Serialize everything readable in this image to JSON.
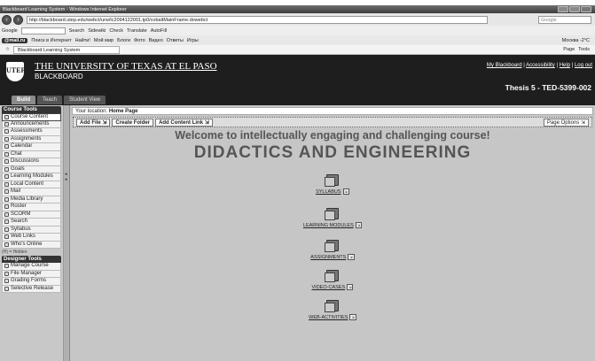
{
  "browser": {
    "window_title": "Blackboard Learning System - Windows Internet Explorer",
    "url": "http://blackboard.utep.edu/webct/urw/lc2094122001.tp0/cobaltMainFrame.dowebct",
    "search_placeholder": "Google",
    "google_label": "Google",
    "google_items": [
      "Search",
      "Sidewiki",
      "Check",
      "Translate",
      "AutoFill"
    ],
    "mail_label": "@mail.ru",
    "mail_items": [
      "Поиск в Интернет",
      "Найти!",
      "Мой мир",
      "Блоги",
      "Фото",
      "Видео",
      "Ответы",
      "Игры"
    ],
    "weather": "Москва -2°C",
    "tab_title": "Blackboard Learning System",
    "tools_items": [
      "Page",
      "Tools"
    ]
  },
  "header": {
    "university": "THE UNIVERSITY OF TEXAS AT EL PASO",
    "system": "BLACKBOARD",
    "links": [
      "My Blackboard",
      "Accessibility",
      "Help",
      "Log out"
    ],
    "course_title": "Thesis 5 - TED-5399-002",
    "tabs": [
      "Build",
      "Teach",
      "Student View"
    ]
  },
  "sidebar": {
    "course_tools_title": "Course Tools",
    "course_tools": [
      {
        "label": "Course Content",
        "icon": "page-icon"
      },
      {
        "label": "Announcements",
        "icon": "megaphone-icon"
      },
      {
        "label": "Assessments",
        "icon": "checklist-icon"
      },
      {
        "label": "Assignments",
        "icon": "clipboard-icon"
      },
      {
        "label": "Calendar",
        "icon": "calendar-icon"
      },
      {
        "label": "Chat",
        "icon": "chat-icon"
      },
      {
        "label": "Discussions",
        "icon": "discussion-icon"
      },
      {
        "label": "Goals",
        "icon": "goal-icon"
      },
      {
        "label": "Learning Modules",
        "icon": "module-icon"
      },
      {
        "label": "Local Content",
        "icon": "local-content-icon"
      },
      {
        "label": "Mail",
        "icon": "mail-icon"
      },
      {
        "label": "Media Library",
        "icon": "media-icon"
      },
      {
        "label": "Roster",
        "icon": "roster-icon"
      },
      {
        "label": "SCORM",
        "icon": "scorm-icon"
      },
      {
        "label": "Search",
        "icon": "search-icon"
      },
      {
        "label": "Syllabus",
        "icon": "syllabus-icon"
      },
      {
        "label": "Web Links",
        "icon": "link-icon"
      },
      {
        "label": "Who's Online",
        "icon": "people-icon"
      }
    ],
    "hidden_note": "(H) = Hidden",
    "designer_tools_title": "Designer Tools",
    "designer_tools": [
      {
        "label": "Manage Course",
        "icon": "manage-icon"
      },
      {
        "label": "File Manager",
        "icon": "folder-icon"
      },
      {
        "label": "Grading Forms",
        "icon": "grading-icon"
      },
      {
        "label": "Selective Release",
        "icon": "release-icon"
      }
    ]
  },
  "main": {
    "location_label": "Your location:",
    "location_value": "Home Page",
    "actions": [
      "Add File",
      "Create Folder",
      "Add Content Link"
    ],
    "page_options": "Page Options",
    "welcome": "Welcome to intellectually engaging and challenging course!",
    "course_name": "DIDACTICS AND ENGINEERING",
    "folders": [
      "SYLLABUS",
      "LEARNING MODULES",
      "ASSIGNMENTS",
      "VIDEO-CASES",
      "WEB-ACTIVITIES"
    ]
  }
}
